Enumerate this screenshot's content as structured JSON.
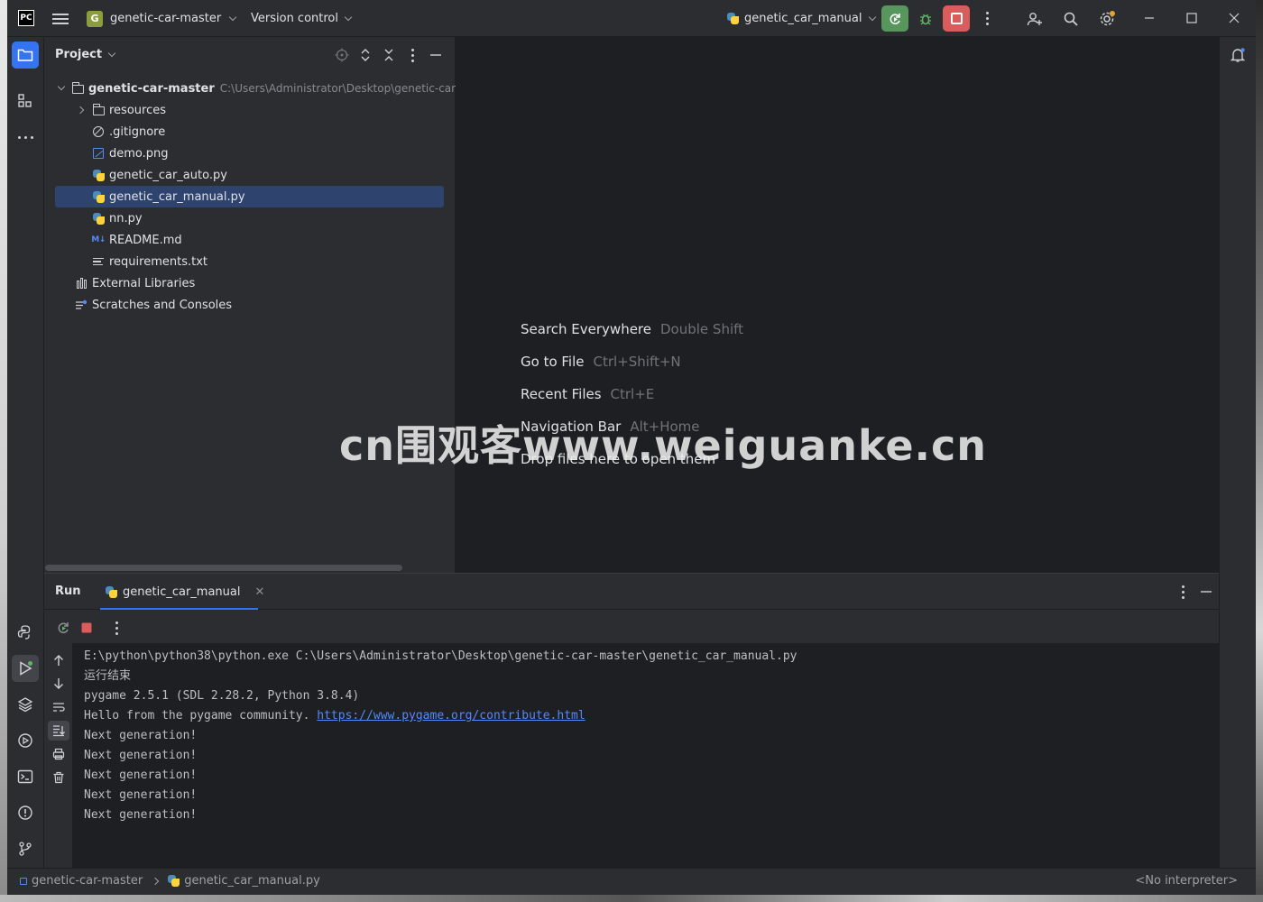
{
  "titlebar": {
    "app_logo_text": "PC",
    "project_badge": "G",
    "project_name": "genetic-car-master",
    "vcs_label": "Version control",
    "run_config": "genetic_car_manual"
  },
  "project_panel": {
    "title": "Project",
    "tree": [
      {
        "label": "genetic-car-master",
        "path": "C:\\Users\\Administrator\\Desktop\\genetic-car",
        "icon": "folder-icon",
        "expanded": true
      },
      {
        "label": "resources",
        "icon": "folder-icon",
        "expanded": false
      },
      {
        "label": ".gitignore",
        "icon": "ignore-file-icon"
      },
      {
        "label": "demo.png",
        "icon": "image-file-icon"
      },
      {
        "label": "genetic_car_auto.py",
        "icon": "python-file-icon"
      },
      {
        "label": "genetic_car_manual.py",
        "icon": "python-file-icon",
        "selected": true
      },
      {
        "label": "nn.py",
        "icon": "python-file-icon"
      },
      {
        "label": "README.md",
        "icon": "markdown-file-icon",
        "icon_text": "M↓"
      },
      {
        "label": "requirements.txt",
        "icon": "text-file-icon"
      },
      {
        "label": "External Libraries",
        "icon": "library-icon"
      },
      {
        "label": "Scratches and Consoles",
        "icon": "scratches-icon"
      }
    ]
  },
  "editor_hints": [
    {
      "action": "Search Everywhere",
      "shortcut": "Double Shift"
    },
    {
      "action": "Go to File",
      "shortcut": "Ctrl+Shift+N"
    },
    {
      "action": "Recent Files",
      "shortcut": "Ctrl+E"
    },
    {
      "action": "Navigation Bar",
      "shortcut": "Alt+Home"
    },
    {
      "action": "Drop files here to open them",
      "shortcut": ""
    }
  ],
  "run_panel": {
    "title": "Run",
    "tab_label": "genetic_car_manual",
    "console_lines": [
      "E:\\python\\python38\\python.exe C:\\Users\\Administrator\\Desktop\\genetic-car-master\\genetic_car_manual.py",
      "运行结束",
      "pygame 2.5.1 (SDL 2.28.2, Python 3.8.4)",
      "Hello from the pygame community. ",
      "Next generation!",
      "Next generation!",
      "Next generation!",
      "Next generation!",
      "Next generation!"
    ],
    "console_link": "https://www.pygame.org/contribute.html"
  },
  "statusbar": {
    "crumb_project": "genetic-car-master",
    "crumb_file": "genetic_car_manual.py",
    "interpreter": "<No interpreter>"
  },
  "watermark": "cn围观客www.weiguanke.cn",
  "colors": {
    "accent": "#3574f0",
    "run_green": "#57965c",
    "stop_red": "#db5c5c",
    "selection": "#2e436e"
  }
}
